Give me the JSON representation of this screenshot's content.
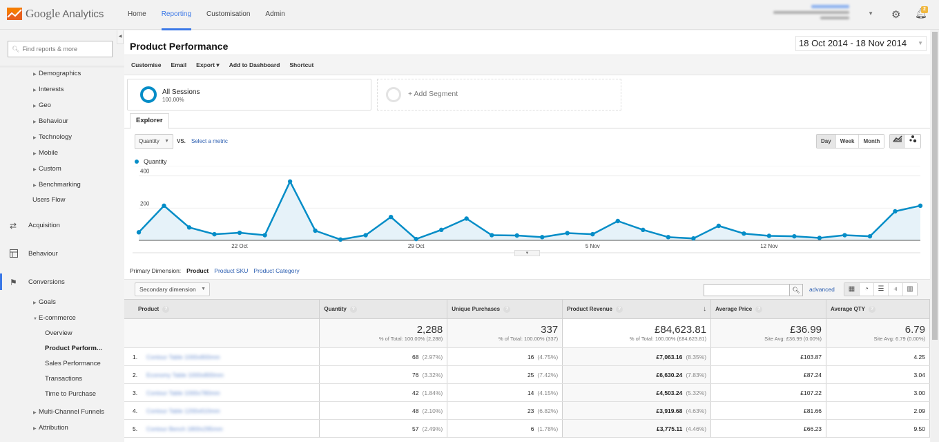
{
  "app": {
    "logo_brand": "Google",
    "logo_product": "Analytics",
    "nav": [
      {
        "label": "Home",
        "active": false
      },
      {
        "label": "Reporting",
        "active": true
      },
      {
        "label": "Customisation",
        "active": false
      },
      {
        "label": "Admin",
        "active": false
      }
    ],
    "account": {
      "caret": "▼"
    },
    "notifications_count": "2",
    "accent_color": "#3b78e7"
  },
  "sidebar": {
    "search_placeholder": "Find reports & more",
    "audience_items": [
      "Demographics",
      "Interests",
      "Geo",
      "Behaviour",
      "Technology",
      "Mobile",
      "Custom",
      "Benchmarking"
    ],
    "users_flow": "Users Flow",
    "sections": [
      {
        "label": "Acquisition",
        "icon": "acquisition-icon"
      },
      {
        "label": "Behaviour",
        "icon": "behaviour-icon"
      },
      {
        "label": "Conversions",
        "icon": "flag-icon",
        "active": true
      }
    ],
    "conversions_items": {
      "goals": "Goals",
      "ecommerce": "E-commerce",
      "ecommerce_children": [
        "Overview",
        "Product Perform...",
        "Sales Performance",
        "Transactions",
        "Time to Purchase"
      ],
      "current": "Product Perform...",
      "multi_channel": "Multi-Channel Funnels",
      "attribution": "Attribution"
    }
  },
  "report": {
    "title": "Product Performance",
    "date_range": "18 Oct 2014 - 18 Nov 2014",
    "actions": [
      "Customise",
      "Email",
      "Export ▾",
      "Add to Dashboard",
      "Shortcut"
    ],
    "segments": {
      "active_name": "All Sessions",
      "active_pct": "100.00%",
      "add_label": "+ Add Segment"
    },
    "tab": "Explorer",
    "metric_select": "Quantity",
    "vs": "VS.",
    "select_metric": "Select a metric",
    "periods": [
      {
        "label": "Day",
        "active": true
      },
      {
        "label": "Week",
        "active": false
      },
      {
        "label": "Month",
        "active": false
      }
    ],
    "legend": "Quantity",
    "primary_dimension": {
      "label": "Primary Dimension:",
      "current": "Product",
      "others": [
        "Product SKU",
        "Product Category"
      ]
    },
    "secondary_dimension": "Secondary dimension",
    "advanced": "advanced",
    "series_color": "#058dc7"
  },
  "chart_data": {
    "type": "area",
    "title": "",
    "xlabel": "",
    "ylabel": "Quantity",
    "x_tick_labels": [
      "22 Oct",
      "29 Oct",
      "5 Nov",
      "12 Nov"
    ],
    "x_tick_indices": [
      4,
      11,
      18,
      25
    ],
    "y_ticks": [
      200,
      400
    ],
    "ylim": [
      0,
      420
    ],
    "grid": true,
    "legend_position": "top-left",
    "series": [
      {
        "name": "Quantity",
        "x": [
          "18 Oct",
          "19 Oct",
          "20 Oct",
          "21 Oct",
          "22 Oct",
          "23 Oct",
          "24 Oct",
          "25 Oct",
          "26 Oct",
          "27 Oct",
          "28 Oct",
          "29 Oct",
          "30 Oct",
          "31 Oct",
          "1 Nov",
          "2 Nov",
          "3 Nov",
          "4 Nov",
          "5 Nov",
          "6 Nov",
          "7 Nov",
          "8 Nov",
          "9 Nov",
          "10 Nov",
          "11 Nov",
          "12 Nov",
          "13 Nov",
          "14 Nov",
          "15 Nov",
          "16 Nov",
          "17 Nov",
          "18 Nov"
        ],
        "values": [
          50,
          215,
          80,
          38,
          47,
          32,
          365,
          60,
          5,
          32,
          145,
          8,
          65,
          135,
          32,
          30,
          20,
          45,
          38,
          120,
          65,
          20,
          12,
          90,
          42,
          28,
          25,
          15,
          32,
          25,
          180,
          215
        ]
      }
    ]
  },
  "table": {
    "columns": [
      {
        "label": "Product",
        "help": "?"
      },
      {
        "label": "Quantity",
        "help": "?"
      },
      {
        "label": "Unique Purchases",
        "help": "?"
      },
      {
        "label": "Product Revenue",
        "help": "?",
        "sorted": "↓"
      },
      {
        "label": "Average Price",
        "help": "?"
      },
      {
        "label": "Average QTY",
        "help": "?"
      }
    ],
    "totals": {
      "quantity": {
        "value": "2,288",
        "sub": "% of Total: 100.00% (2,288)"
      },
      "unique_purchases": {
        "value": "337",
        "sub": "% of Total: 100.00% (337)"
      },
      "revenue": {
        "value": "£84,623.81",
        "sub": "% of Total: 100.00% (£84,623.81)"
      },
      "avg_price": {
        "value": "£36.99",
        "sub": "Site Avg: £36.99 (0.00%)"
      },
      "avg_qty": {
        "value": "6.79",
        "sub": "Site Avg: 6.79 (0.00%)"
      }
    },
    "rows": [
      {
        "num": "1.",
        "product": "Contour Table 1000x800mm",
        "quantity": "68",
        "quantity_pct": "(2.97%)",
        "unique": "16",
        "unique_pct": "(4.75%)",
        "revenue": "£7,063.16",
        "revenue_pct": "(8.35%)",
        "avg_price": "£103.87",
        "avg_qty": "4.25"
      },
      {
        "num": "2.",
        "product": "Economy Table 1000x800mm",
        "quantity": "76",
        "quantity_pct": "(3.32%)",
        "unique": "25",
        "unique_pct": "(7.42%)",
        "revenue": "£6,630.24",
        "revenue_pct": "(7.83%)",
        "avg_price": "£87.24",
        "avg_qty": "3.04"
      },
      {
        "num": "3.",
        "product": "Contour Table 1000x780mm",
        "quantity": "42",
        "quantity_pct": "(1.84%)",
        "unique": "14",
        "unique_pct": "(4.15%)",
        "revenue": "£4,503.24",
        "revenue_pct": "(5.32%)",
        "avg_price": "£107.22",
        "avg_qty": "3.00"
      },
      {
        "num": "4.",
        "product": "Contour Table 1200x610mm",
        "quantity": "48",
        "quantity_pct": "(2.10%)",
        "unique": "23",
        "unique_pct": "(6.82%)",
        "revenue": "£3,919.68",
        "revenue_pct": "(4.63%)",
        "avg_price": "£81.66",
        "avg_qty": "2.09"
      },
      {
        "num": "5.",
        "product": "Contour Bench 1800x295mm",
        "quantity": "57",
        "quantity_pct": "(2.49%)",
        "unique": "6",
        "unique_pct": "(1.78%)",
        "revenue": "£3,775.11",
        "revenue_pct": "(4.46%)",
        "avg_price": "£66.23",
        "avg_qty": "9.50"
      }
    ]
  }
}
